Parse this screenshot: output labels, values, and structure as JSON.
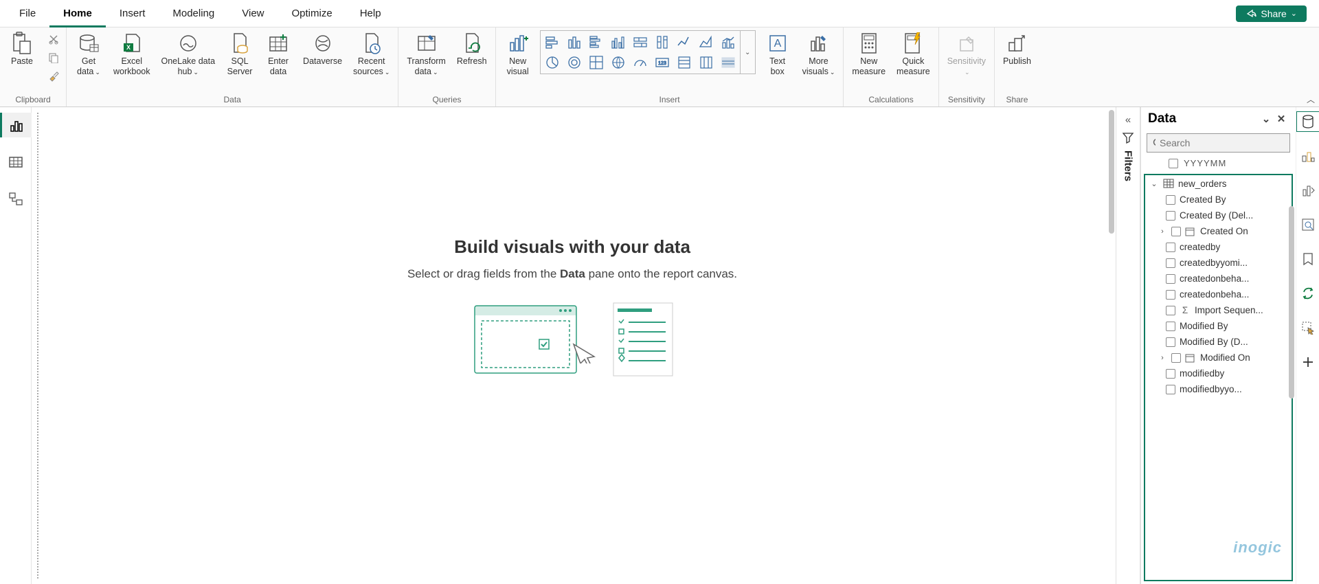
{
  "menubar": {
    "tabs": [
      "File",
      "Home",
      "Insert",
      "Modeling",
      "View",
      "Optimize",
      "Help"
    ],
    "active_index": 1,
    "share_label": "Share"
  },
  "ribbon": {
    "groups": {
      "clipboard": {
        "label": "Clipboard",
        "paste": "Paste"
      },
      "data": {
        "label": "Data",
        "items": [
          "Get\ndata",
          "Excel\nworkbook",
          "OneLake data\nhub",
          "SQL\nServer",
          "Enter\ndata",
          "Dataverse",
          "Recent\nsources"
        ]
      },
      "queries": {
        "label": "Queries",
        "transform": "Transform\ndata",
        "refresh": "Refresh"
      },
      "insert": {
        "label": "Insert",
        "new_visual": "New\nvisual",
        "text_box": "Text\nbox",
        "more_visuals": "More\nvisuals"
      },
      "calculations": {
        "label": "Calculations",
        "new_measure": "New\nmeasure",
        "quick_measure": "Quick\nmeasure"
      },
      "sensitivity": {
        "label": "Sensitivity",
        "item": "Sensitivity"
      },
      "share": {
        "label": "Share",
        "publish": "Publish"
      }
    }
  },
  "canvas": {
    "heading": "Build visuals with your data",
    "sub_pre": "Select or drag fields from the ",
    "sub_bold": "Data",
    "sub_post": " pane onto the report canvas."
  },
  "filters": {
    "label": "Filters"
  },
  "data_pane": {
    "title": "Data",
    "search_placeholder": "Search",
    "truncated_field_above": "YYYYMM",
    "table_name": "new_orders",
    "fields": [
      {
        "label": "Created By",
        "expandable": false,
        "icon": ""
      },
      {
        "label": "Created By (Del...",
        "expandable": false,
        "icon": ""
      },
      {
        "label": "Created On",
        "expandable": true,
        "icon": "date"
      },
      {
        "label": "createdby",
        "expandable": false,
        "icon": ""
      },
      {
        "label": "createdbyyomi...",
        "expandable": false,
        "icon": ""
      },
      {
        "label": "createdonbeha...",
        "expandable": false,
        "icon": ""
      },
      {
        "label": "createdonbeha...",
        "expandable": false,
        "icon": ""
      },
      {
        "label": "Import Sequen...",
        "expandable": false,
        "icon": "sigma"
      },
      {
        "label": "Modified By",
        "expandable": false,
        "icon": ""
      },
      {
        "label": "Modified By (D...",
        "expandable": false,
        "icon": ""
      },
      {
        "label": "Modified On",
        "expandable": true,
        "icon": "date"
      },
      {
        "label": "modifiedby",
        "expandable": false,
        "icon": ""
      },
      {
        "label": "modifiedbyyo...",
        "expandable": false,
        "icon": ""
      }
    ]
  },
  "watermark": "inogic"
}
